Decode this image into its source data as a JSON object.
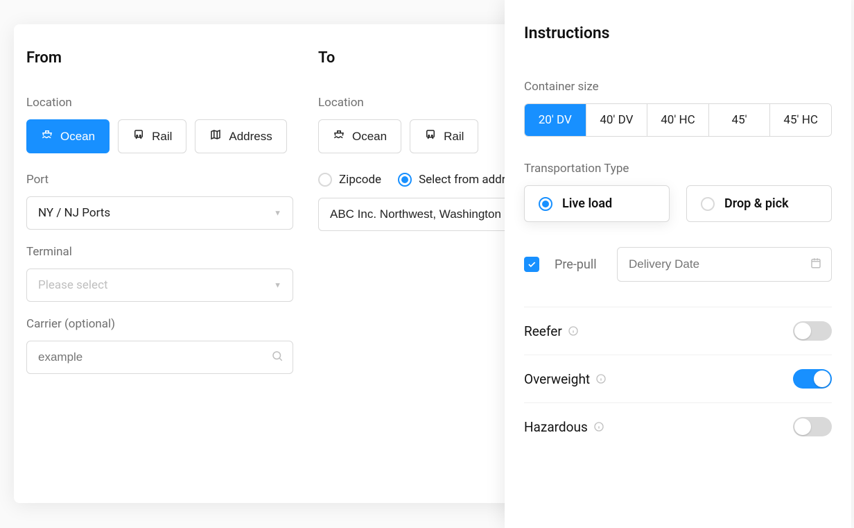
{
  "from": {
    "title": "From",
    "location_label": "Location",
    "location_options": {
      "ocean": "Ocean",
      "rail": "Rail",
      "address": "Address"
    },
    "port_label": "Port",
    "port_value": "NY / NJ Ports",
    "terminal_label": "Terminal",
    "terminal_placeholder": "Please select",
    "carrier_label": "Carrier (optional)",
    "carrier_placeholder": "example"
  },
  "to": {
    "title": "To",
    "location_label": "Location",
    "location_options": {
      "ocean": "Ocean",
      "rail": "Rail"
    },
    "zipcode_label": "Zipcode",
    "select_address_label": "Select from address book",
    "address_value": "ABC Inc. Northwest, Washington D.C"
  },
  "instructions": {
    "title": "Instructions",
    "container_size_label": "Container size",
    "container_sizes": [
      "20' DV",
      "40' DV",
      "40' HC",
      "45'",
      "45' HC"
    ],
    "transport_type_label": "Transportation Type",
    "transport_options": {
      "live": "Live load",
      "drop": "Drop & pick"
    },
    "prepull_label": "Pre-pull",
    "delivery_date_placeholder": "Delivery Date",
    "toggles": {
      "reefer": "Reefer",
      "overweight": "Overweight",
      "hazardous": "Hazardous"
    }
  }
}
